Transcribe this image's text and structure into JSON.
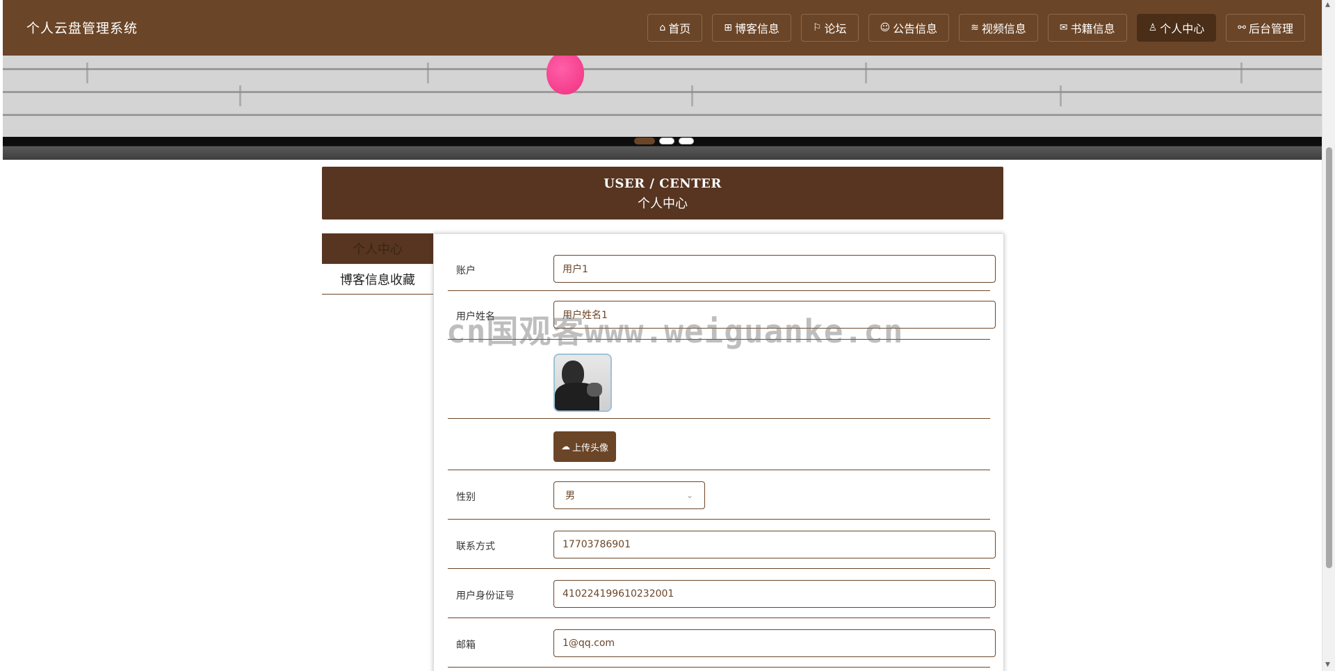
{
  "site_title": "个人云盘管理系统",
  "nav": [
    {
      "icon": "⌂",
      "label": "首页",
      "name": "home"
    },
    {
      "icon": "⊞",
      "label": "博客信息",
      "name": "blog"
    },
    {
      "icon": "⚐",
      "label": "论坛",
      "name": "forum"
    },
    {
      "icon": "☺",
      "label": "公告信息",
      "name": "notice"
    },
    {
      "icon": "≋",
      "label": "视频信息",
      "name": "video"
    },
    {
      "icon": "✉",
      "label": "书籍信息",
      "name": "books"
    },
    {
      "icon": "♙",
      "label": "个人中心",
      "name": "profile"
    },
    {
      "icon": "⚯",
      "label": "后台管理",
      "name": "admin"
    }
  ],
  "section": {
    "en": "USER / CENTER",
    "cn": "个人中心"
  },
  "side_menu": [
    {
      "label": "个人中心",
      "active": true
    },
    {
      "label": "博客信息收藏",
      "active": false
    }
  ],
  "form": {
    "account_label": "账户",
    "account_value": "用户1",
    "name_label": "用户姓名",
    "name_value": "用户姓名1",
    "upload_label": "上传头像",
    "gender_label": "性别",
    "gender_value": "男",
    "phone_label": "联系方式",
    "phone_value": "17703786901",
    "idcard_label": "用户身份证号",
    "idcard_value": "410224199610232001",
    "email_label": "邮箱",
    "email_value": "1@qq.com"
  },
  "watermark": "cn国观客www.weiguanke.cn",
  "colors": {
    "brand": "#6b4527",
    "dark": "#573521",
    "accent": "#f0307f"
  }
}
